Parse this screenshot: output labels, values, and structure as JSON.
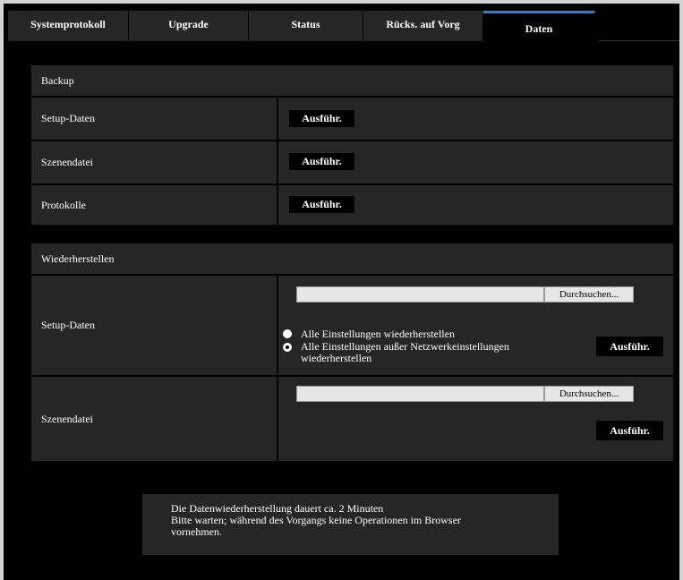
{
  "tabs": [
    {
      "label": "Systemprotokoll",
      "active": false
    },
    {
      "label": "Upgrade",
      "active": false
    },
    {
      "label": "Status",
      "active": false
    },
    {
      "label": "Rücks. auf Vorg",
      "active": false
    },
    {
      "label": "Daten",
      "active": true
    }
  ],
  "backup": {
    "title": "Backup",
    "rows": [
      {
        "label": "Setup-Daten",
        "button": "Ausführ."
      },
      {
        "label": "Szenendatei",
        "button": "Ausführ."
      },
      {
        "label": "Protokolle",
        "button": "Ausführ."
      }
    ]
  },
  "restore": {
    "title": "Wiederherstellen",
    "setup": {
      "label": "Setup-Daten",
      "browse_label": "Durchsuchen...",
      "file_value": "",
      "option1": "Alle Einstellungen wiederherstellen",
      "option2": "Alle Einstellungen außer Netzwerkeinstellungen wiederherstellen",
      "option2_line1": "Alle Einstellungen außer Netzwerkeinstellungen",
      "option2_line2": "wiederherstellen",
      "selected_option": 2,
      "button": "Ausführ."
    },
    "scene": {
      "label": "Szenendatei",
      "browse_label": "Durchsuchen...",
      "file_value": "",
      "button": "Ausführ."
    }
  },
  "notice": {
    "line1": "Die Datenwiederherstellung dauert ca. 2 Minuten",
    "line2": "Bitte warten; während des Vorgangs keine Operationen im Browser",
    "line3": "vornehmen."
  },
  "colors": {
    "background": "#000000",
    "panel": "#262626",
    "active_tab_accent": "#2f7fc1"
  }
}
